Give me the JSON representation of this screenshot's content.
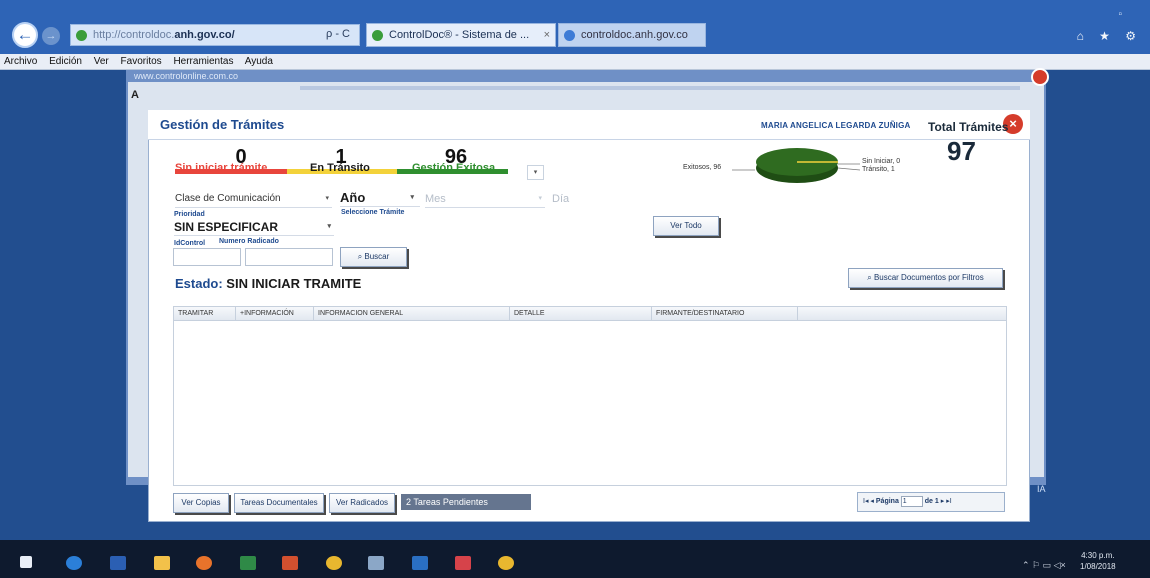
{
  "browser": {
    "url_prefix": "http://controldoc.",
    "url_domain": "anh.gov.co/",
    "url_tools": "ρ ‑ C",
    "tabs": [
      {
        "label": "ControlDoc® - Sistema de ...",
        "close": "×"
      },
      {
        "label": "controldoc.anh.gov.co"
      }
    ],
    "menu": [
      "Archivo",
      "Edición",
      "Ver",
      "Favoritos",
      "Herramientas",
      "Ayuda"
    ],
    "back_glyph": "←",
    "forward_glyph": "→",
    "right_icons": "⌂ ★ ⚙",
    "window_control": "▫"
  },
  "page": {
    "url_strip": "www.controlonline.com.co",
    "side_letter": "A",
    "side_text": "IA"
  },
  "modal": {
    "title": "Gestión de Trámites",
    "user": "MARIA ANGELICA LEGARDA ZUÑIGA",
    "close_glyph": "×"
  },
  "counters": {
    "sin_iniciar": {
      "value": "0",
      "label": "Sin iniciar trámite",
      "color": "#e8453c"
    },
    "en_transito": {
      "value": "1",
      "label": "En Tránsito",
      "color": "#f3d23a"
    },
    "exitosa": {
      "value": "96",
      "label": "Gestión Exitosa",
      "color": "#2f8f2f"
    },
    "drop_glyph": "▾"
  },
  "chart": {
    "label_exitosos": "Exitosos, 96",
    "label_sin_iniciar": "Sin Iniciar, 0",
    "label_transito": "Tránsito, 1",
    "total_label": "Total Trámites",
    "total_value": "97",
    "pie_color": "#2f6b20"
  },
  "chart_data": {
    "type": "pie",
    "categories": [
      "Exitosos",
      "Sin Iniciar",
      "Tránsito"
    ],
    "values": [
      96,
      0,
      1
    ]
  },
  "filters": {
    "clase": "Clase de Comunicación",
    "anio": "Año",
    "mes": "Mes",
    "dia": "Día",
    "prioridad_label": "Prioridad",
    "prioridad_value": "SIN ESPECIFICAR",
    "tramite_label": "Seleccione Trámite",
    "idcontrol_label": "IdControl",
    "radicado_label": "Numero Radicado",
    "buscar": "Buscar",
    "ver_todo": "Ver Todo",
    "buscar_filtros": "Buscar Documentos por Filtros",
    "caret": "▾"
  },
  "estado": {
    "label": "Estado:",
    "value": "SIN INICIAR TRAMITE"
  },
  "grid": {
    "columns": [
      "TRAMITAR",
      "+INFORMACIÓN",
      "INFORMACION GENERAL",
      "DETALLE",
      "FIRMANTE/DESTINATARIO"
    ]
  },
  "footer": {
    "ver_copias": "Ver Copias",
    "tareas_documentales": "Tareas Documentales",
    "ver_radicados": "Ver Radicados",
    "pending": "2 Tareas Pendientes",
    "pager_first": "I◂",
    "pager_prev": "◂",
    "pager_label": "Página",
    "pager_value": "1",
    "pager_of": "de 1",
    "pager_next": "▸",
    "pager_last": "▸I"
  },
  "taskbar": {
    "tray": "⌃ ⚐ ▭ ◁×",
    "time": "4:30 p.m.",
    "date": "1/08/2018"
  }
}
